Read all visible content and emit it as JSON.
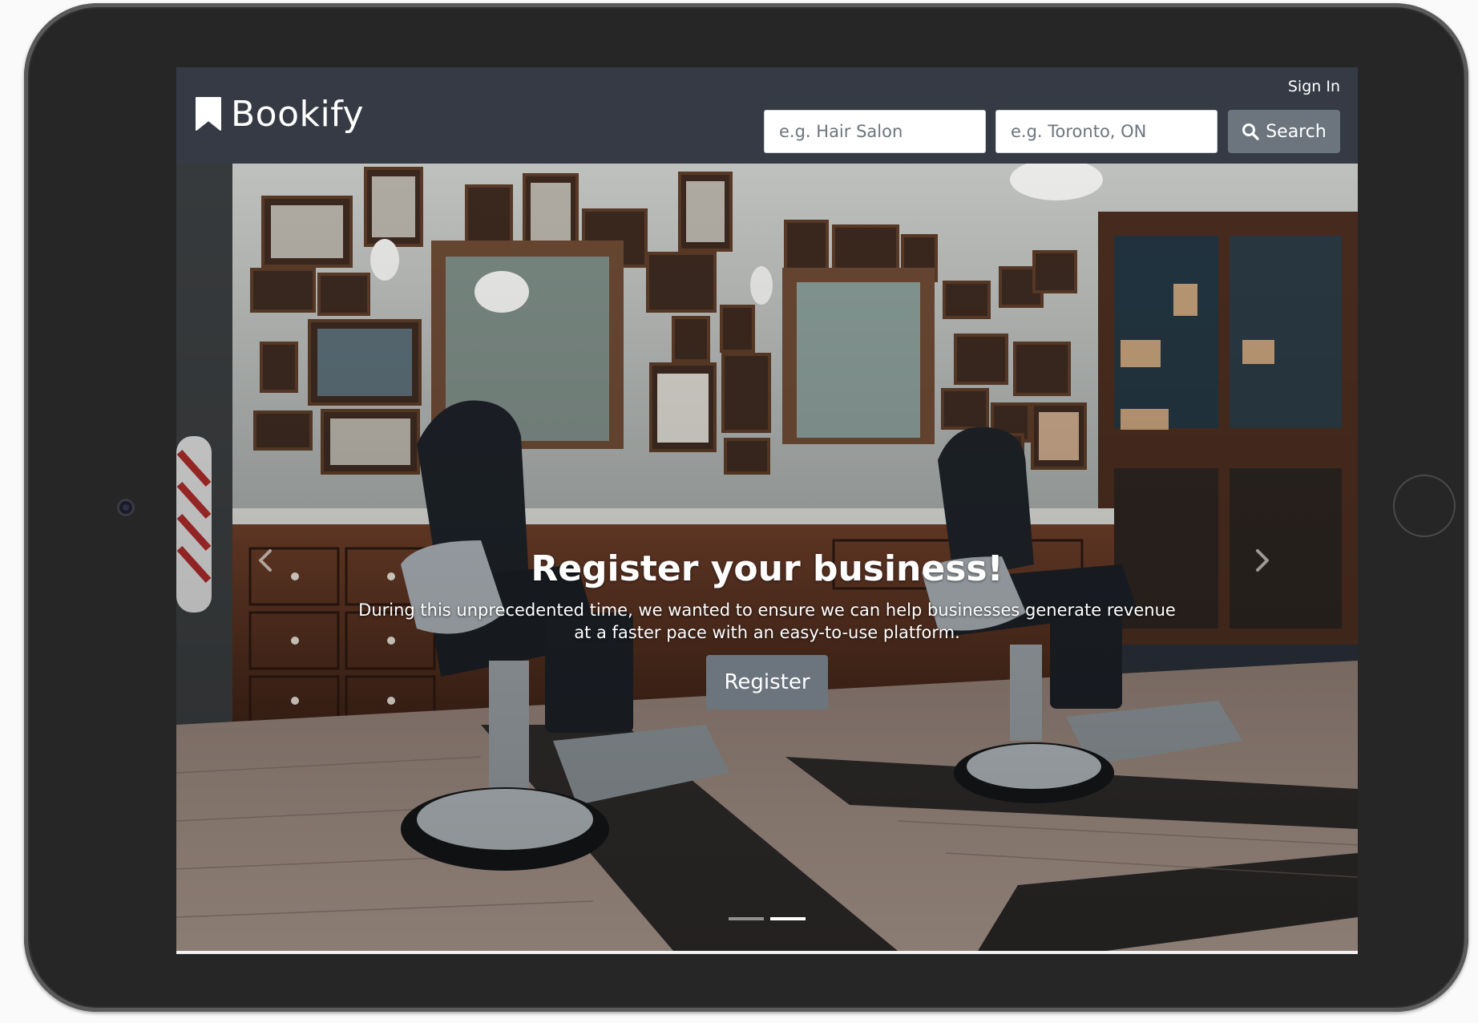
{
  "navbar": {
    "brand_name": "Bookify",
    "brand_icon": "bookmark-icon",
    "sign_in_label": "Sign In",
    "search": {
      "service_placeholder": "e.g. Hair Salon",
      "location_placeholder": "e.g. Toronto, ON",
      "button_label": "Search",
      "button_icon": "search-icon"
    }
  },
  "hero": {
    "background_image": "barbershop-interior-photo",
    "title": "Register your business!",
    "description": "During this unprecedented time, we wanted to ensure we can help businesses generate revenue at a faster pace with an easy-to-use platform.",
    "register_label": "Register",
    "prev_icon": "chevron-left-icon",
    "next_icon": "chevron-right-icon",
    "slide_count": 2,
    "active_slide": 2
  },
  "colors": {
    "navbar_bg": "#353a45",
    "button_bg": "#6c757d",
    "device_frame": "#262626",
    "text_light": "#ffffff"
  }
}
